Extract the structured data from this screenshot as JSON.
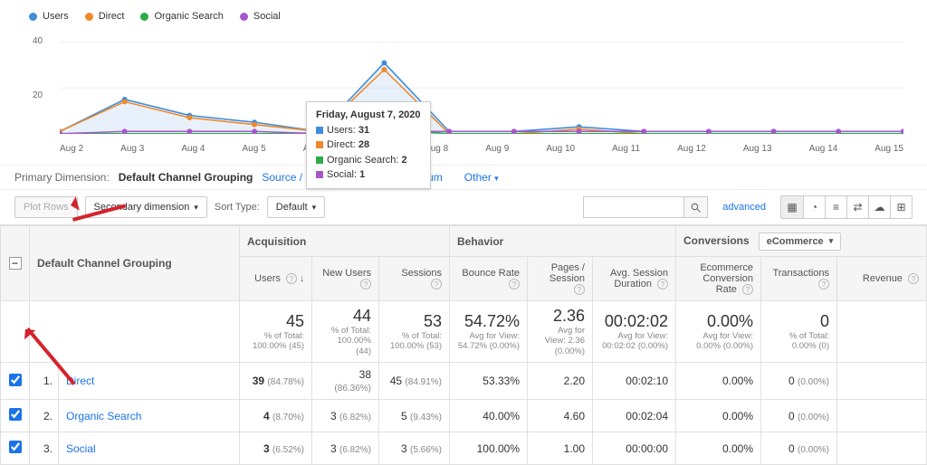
{
  "chart_data": {
    "type": "line",
    "x_categories": [
      "Aug 2",
      "Aug 3",
      "Aug 4",
      "Aug 5",
      "Aug 6",
      "Aug 7",
      "Aug 8",
      "Aug 9",
      "Aug 10",
      "Aug 11",
      "Aug 12",
      "Aug 13",
      "Aug 14",
      "Aug 15"
    ],
    "series": [
      {
        "name": "Users",
        "color": "#3f8ddb",
        "values": [
          1,
          15,
          8,
          5,
          1,
          31,
          1,
          1,
          3,
          1,
          1,
          1,
          1,
          1
        ]
      },
      {
        "name": "Direct",
        "color": "#f08a2c",
        "values": [
          1,
          14,
          7,
          4,
          1,
          28,
          0,
          0,
          2,
          0,
          0,
          0,
          0,
          0
        ]
      },
      {
        "name": "Organic Search",
        "color": "#2bab4a",
        "values": [
          0,
          0,
          0,
          0,
          0,
          2,
          0,
          0,
          0,
          0,
          0,
          0,
          0,
          0
        ]
      },
      {
        "name": "Social",
        "color": "#a757cc",
        "values": [
          0,
          1,
          1,
          1,
          0,
          1,
          1,
          1,
          1,
          1,
          1,
          1,
          1,
          1
        ]
      }
    ],
    "ylim": [
      0,
      45
    ],
    "yticks": [
      20,
      40
    ]
  },
  "tooltip": {
    "title": "Friday, August 7, 2020",
    "rows": [
      {
        "label": "Users",
        "value": "31",
        "color": "#3f8ddb"
      },
      {
        "label": "Direct",
        "value": "28",
        "color": "#f08a2c"
      },
      {
        "label": "Organic Search",
        "value": "2",
        "color": "#2bab4a"
      },
      {
        "label": "Social",
        "value": "1",
        "color": "#a757cc"
      }
    ]
  },
  "dims": {
    "label": "Primary Dimension:",
    "active": "Default Channel Grouping",
    "items": [
      "Source / Medium",
      "Source",
      "Medium"
    ],
    "other": "Other"
  },
  "toolbar": {
    "plot_rows": "Plot Rows",
    "secondary": "Secondary dimension",
    "sort_label": "Sort Type:",
    "sort_default": "Default",
    "advanced": "advanced"
  },
  "table": {
    "main_dim_label": "Default Channel Grouping",
    "groups": {
      "acq": "Acquisition",
      "beh": "Behavior",
      "conv": "Conversions",
      "conv_selector": "eCommerce"
    },
    "cols": [
      "Users",
      "New Users",
      "Sessions",
      "Bounce Rate",
      "Pages / Session",
      "Avg. Session Duration",
      "Ecommerce Conversion Rate",
      "Transactions",
      "Revenue"
    ],
    "totals": {
      "users": {
        "big": "45",
        "sub": "% of Total: 100.00% (45)"
      },
      "newusers": {
        "big": "44",
        "sub": "% of Total: 100.00% (44)"
      },
      "sessions": {
        "big": "53",
        "sub": "% of Total: 100.00% (53)"
      },
      "bounce": {
        "big": "54.72%",
        "sub": "Avg for View: 54.72% (0.00%)"
      },
      "pps": {
        "big": "2.36",
        "sub": "Avg for View: 2.36 (0.00%)"
      },
      "dur": {
        "big": "00:02:02",
        "sub": "Avg for View: 00:02:02 (0.00%)"
      },
      "ecr": {
        "big": "0.00%",
        "sub": "Avg for View: 0.00% (0.00%)"
      },
      "tx": {
        "big": "0",
        "sub": "% of Total: 0.00% (0)"
      },
      "rev": {
        "big": "",
        "sub": ""
      }
    },
    "rows": [
      {
        "rank": "1.",
        "name": "Direct",
        "users": "39",
        "users_pct": "(84.78%)",
        "newusers": "38",
        "newusers_pct": "(86.36%)",
        "sessions": "45",
        "sessions_pct": "(84.91%)",
        "bounce": "53.33%",
        "pps": "2.20",
        "dur": "00:02:10",
        "ecr": "0.00%",
        "tx": "0",
        "tx_pct": "(0.00%)",
        "rev": ""
      },
      {
        "rank": "2.",
        "name": "Organic Search",
        "users": "4",
        "users_pct": "(8.70%)",
        "newusers": "3",
        "newusers_pct": "(6.82%)",
        "sessions": "5",
        "sessions_pct": "(9.43%)",
        "bounce": "40.00%",
        "pps": "4.60",
        "dur": "00:02:04",
        "ecr": "0.00%",
        "tx": "0",
        "tx_pct": "(0.00%)",
        "rev": ""
      },
      {
        "rank": "3.",
        "name": "Social",
        "users": "3",
        "users_pct": "(6.52%)",
        "newusers": "3",
        "newusers_pct": "(6.82%)",
        "sessions": "3",
        "sessions_pct": "(5.66%)",
        "bounce": "100.00%",
        "pps": "1.00",
        "dur": "00:00:00",
        "ecr": "0.00%",
        "tx": "0",
        "tx_pct": "(0.00%)",
        "rev": ""
      }
    ]
  }
}
